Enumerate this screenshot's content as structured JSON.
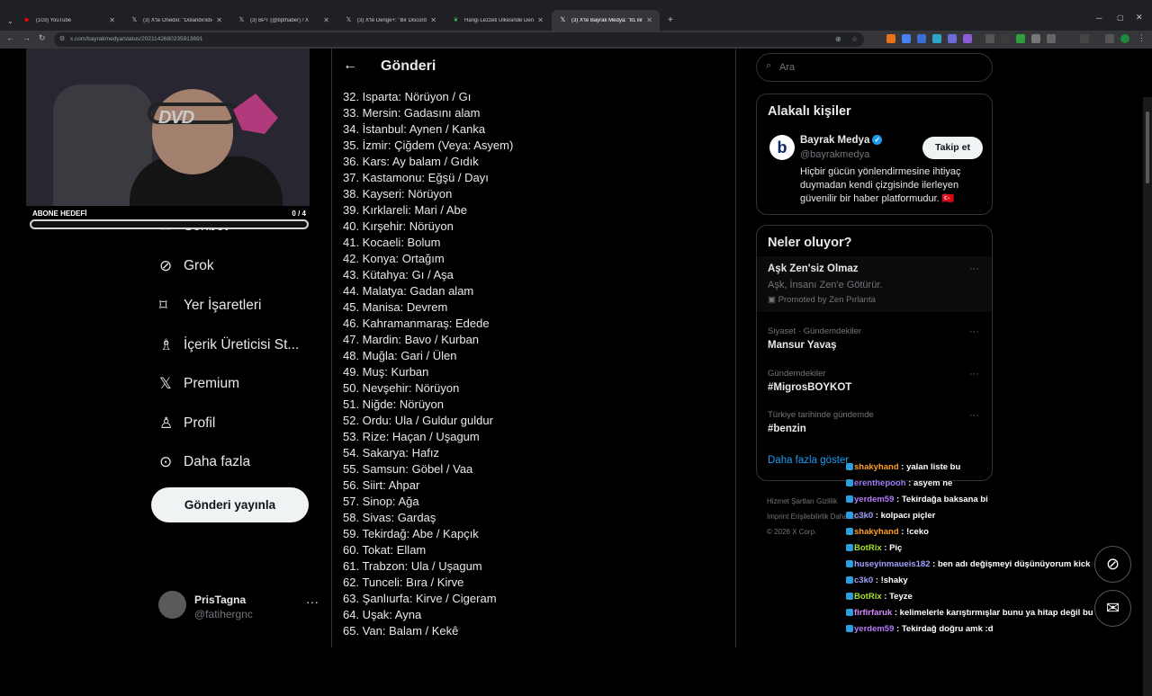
{
  "browser": {
    "tabs": [
      {
        "title": "(103) YouTube",
        "favicon": "youtube-icon",
        "color": "#ff0000"
      },
      {
        "title": "(3) X'te Onedio: \"Dolandırıldığ...",
        "favicon": "x-icon",
        "color": "#ffffff"
      },
      {
        "title": "(3) BPT (@bpthaber) / X",
        "favicon": "x-icon",
        "color": "#ffffff"
      },
      {
        "title": "(3) X'te Denge+: \"Bir Discord ka...",
        "favicon": "x-icon",
        "color": "#ffffff"
      },
      {
        "title": "Hangi Lezzeti Ülkesinde Denem...",
        "favicon": "leaf-icon",
        "color": "#4caf50"
      },
      {
        "title": "(3) X'te Bayrak Medya: \"81 ilin...",
        "favicon": "x-icon",
        "color": "#ffffff"
      }
    ],
    "url": "x.com/bayrakmedya/status/2021142680235913691"
  },
  "sidebar": {
    "items": [
      {
        "label": "Sohbet",
        "icon": "mail-icon",
        "glyph": "✉"
      },
      {
        "label": "Grok",
        "icon": "grok-icon",
        "glyph": "⊘"
      },
      {
        "label": "Yer İşaretleri",
        "icon": "bookmark-icon",
        "glyph": "🔖"
      },
      {
        "label": "İçerik Üreticisi St...",
        "icon": "creator-studio-icon",
        "glyph": "♗"
      },
      {
        "label": "Premium",
        "icon": "x-logo-icon",
        "glyph": "𝕏"
      },
      {
        "label": "Profil",
        "icon": "person-icon",
        "glyph": "👤"
      },
      {
        "label": "Daha fazla",
        "icon": "more-circle-icon",
        "glyph": "⊙"
      }
    ],
    "post_button": "Gönderi yayınla",
    "profile": {
      "name": "PrisTagna",
      "handle": "@fatihergnc",
      "more": "···"
    }
  },
  "post": {
    "header_title": "Gönderi",
    "lines": [
      "32. Isparta: Nörüyon / Gı",
      "33. Mersin: Gadasını alam",
      "34. İstanbul: Aynen / Kanka",
      "35. İzmir: Çiğdem (Veya: Asyem)",
      "36. Kars: Ay balam / Gıdık",
      "37. Kastamonu: Eğşü / Dayı",
      "38. Kayseri: Nörüyon",
      "39. Kırklareli: Mari / Abe",
      "40. Kırşehir: Nörüyon",
      "41. Kocaeli: Bolum",
      "42. Konya: Ortağım",
      "43. Kütahya: Gı / Aşa",
      "44. Malatya: Gadan alam",
      "45. Manisa: Devrem",
      "46. Kahramanmaraş: Edede",
      "47. Mardin: Bavo / Kurban",
      "48. Muğla: Gari / Ülen",
      "49. Muş: Kurban",
      "50. Nevşehir: Nörüyon",
      "51. Niğde: Nörüyon",
      "52. Ordu: Ula / Guldur guldur",
      "53. Rize: Haçan / Uşagum",
      "54. Sakarya: Hafız",
      "55. Samsun: Göbel / Vaa",
      "56. Siirt: Ahpar",
      "57. Sinop: Ağa",
      "58. Sivas: Gardaş",
      "59. Tekirdağ: Abe / Kapçık",
      "60. Tokat: Ellam",
      "61. Trabzon: Ula / Uşagum",
      "62. Tunceli: Bıra / Kirve",
      "63. Şanlıurfa: Kirve / Cigeram",
      "64. Uşak: Ayna",
      "65. Van: Balam / Kekê"
    ]
  },
  "right": {
    "search_placeholder": "Ara",
    "related": {
      "title": "Alakalı kişiler",
      "name": "Bayrak Medya",
      "handle": "@bayrakmedya",
      "bio": "Hiçbir gücün yönlendirmesine ihtiyaç duymadan kendi çizgisinde ilerleyen güvenilir bir haber platformudur. 🇹🇷",
      "follow": "Takip et",
      "logo_letter": "b"
    },
    "trends": {
      "title": "Neler oluyor?",
      "promo": {
        "title": "Aşk Zen'siz Olmaz",
        "subtitle": "Aşk, İnsanı Zen'e Götürür.",
        "promoted": "Promoted by Zen Pırlanta"
      },
      "items": [
        {
          "context": "Siyaset · Gündemdekiler",
          "topic": "Mansur Yavaş"
        },
        {
          "context": "Gündemdekiler",
          "topic": "#MigrosBOYKOT"
        },
        {
          "context": "Türkiye tarihinde gündemde",
          "topic": "#benzin"
        }
      ],
      "show_more": "Daha fazla göster"
    },
    "footer": {
      "line1": "Hizmet Şartları   Gizlilik",
      "line2": "Imprint   Erişilebilirlik   Daha fazla ···",
      "line3": "© 2026 X Corp."
    }
  },
  "stream": {
    "goal_label": "ABONE HEDEFİ",
    "goal_count": "0 / 4",
    "goal_progress": 0,
    "dvd_logo": "DVD",
    "chat": [
      {
        "user": "shakyhand",
        "color": "#ff9f1c",
        "msg": " : yalan liste bu"
      },
      {
        "user": "erenthepooh",
        "color": "#9b7cf2",
        "msg": " : asyem ne"
      },
      {
        "user": "yerdem59",
        "color": "#b37cff",
        "msg": " : Tekirdağa baksana bi"
      },
      {
        "user": "c3k0",
        "color": "#a0a0ff",
        "msg": " : kolpacı piçler"
      },
      {
        "user": "shakyhand",
        "color": "#ff9f1c",
        "msg": " : !ceko"
      },
      {
        "user": "BotRix",
        "color": "#a6e22e",
        "msg": " : Piç"
      },
      {
        "user": "huseyinmaueis182",
        "color": "#a0a0ff",
        "msg": " : ben adı değişmeyi düşünüyorum kick"
      },
      {
        "user": "c3k0",
        "color": "#a0a0ff",
        "msg": " : !shaky"
      },
      {
        "user": "BotRix",
        "color": "#a6e22e",
        "msg": " : Teyze"
      },
      {
        "user": "firfirfaruk",
        "color": "#d88cff",
        "msg": " : kelimelerle karıştırmışlar bunu ya hitap değil bu"
      },
      {
        "user": "yerdem59",
        "color": "#b37cff",
        "msg": " : Tekirdağ doğru amk :d"
      }
    ]
  },
  "fabs": [
    {
      "icon": "grok-icon",
      "glyph": "⊘"
    },
    {
      "icon": "message-icon",
      "glyph": "✉"
    }
  ]
}
